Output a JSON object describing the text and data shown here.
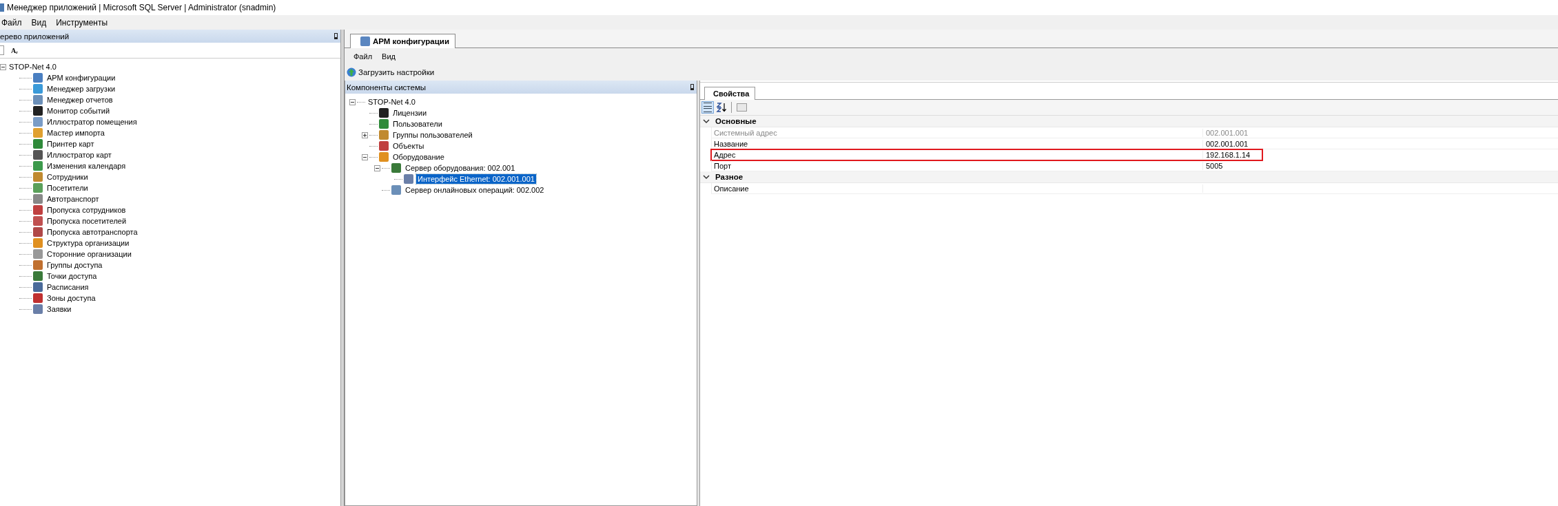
{
  "window": {
    "title": "Менеджер приложений | Microsoft SQL Server | Administrator  (snadmin)"
  },
  "menu": [
    "Файл",
    "Вид",
    "Инструменты"
  ],
  "app_tree": {
    "title": "ерево приложений",
    "toolbar": [
      "Aᵣ"
    ],
    "root": {
      "label": "STOP-Net 4.0",
      "expanded": true,
      "children": [
        {
          "label": "АРМ конфигурации"
        },
        {
          "label": "Менеджер загрузки"
        },
        {
          "label": "Менеджер отчетов"
        },
        {
          "label": "Монитор событий"
        },
        {
          "label": "Иллюстратор помещения"
        },
        {
          "label": "Мастер импорта"
        },
        {
          "label": "Принтер карт"
        },
        {
          "label": "Иллюстратор карт"
        },
        {
          "label": "Изменения календаря"
        },
        {
          "label": "Сотрудники"
        },
        {
          "label": "Посетители"
        },
        {
          "label": "Автотранспорт"
        },
        {
          "label": "Пропуска сотрудников"
        },
        {
          "label": "Пропуска посетителей"
        },
        {
          "label": "Пропуска автотранспорта"
        },
        {
          "label": "Структура организации"
        },
        {
          "label": "Сторонние организации"
        },
        {
          "label": "Группы доступа"
        },
        {
          "label": "Точки доступа"
        },
        {
          "label": "Расписания"
        },
        {
          "label": "Зоны доступа"
        },
        {
          "label": "Заявки"
        }
      ]
    }
  },
  "document_tabs": [
    {
      "label": "АРМ конфигурации",
      "selected": true
    }
  ],
  "doc_menu": [
    "Файл",
    "Вид"
  ],
  "doc_toolbar": {
    "load_button": "Загрузить настройки"
  },
  "components": {
    "title": "Компоненты системы",
    "root": {
      "label": "STOP-Net 4.0",
      "expanded": true,
      "selected": false,
      "children": [
        {
          "label": "Лицензии",
          "selected": false
        },
        {
          "label": "Пользователи",
          "selected": false
        },
        {
          "label": "Группы пользователей",
          "expanded": false,
          "selected": false
        },
        {
          "label": "Объекты",
          "selected": false
        },
        {
          "label": "Оборудование",
          "expanded": true,
          "selected": false,
          "children": [
            {
              "label": "Сервер оборудования: 002.001",
              "expanded": true,
              "selected": false,
              "children": [
                {
                  "label": "Интерфейс Ethernet: 002.001.001",
                  "selected": true
                }
              ]
            },
            {
              "label": "Сервер онлайновых операций: 002.002",
              "selected": false
            }
          ]
        }
      ]
    }
  },
  "properties": {
    "tabs": [
      {
        "label": "Свойства",
        "selected": true
      }
    ],
    "categories": [
      {
        "name": "Основные",
        "expanded": true,
        "rows": [
          {
            "name": "Системный адрес",
            "value": "002.001.001",
            "readonly": true,
            "highlighted": false
          },
          {
            "name": "Название",
            "value": "002.001.001",
            "readonly": false,
            "highlighted": false
          },
          {
            "name": "Адрес",
            "value": "192.168.1.14",
            "readonly": false,
            "highlighted": true
          },
          {
            "name": "Порт",
            "value": "5005",
            "readonly": false,
            "highlighted": false
          }
        ]
      },
      {
        "name": "Разное",
        "expanded": true,
        "rows": [
          {
            "name": "Описание",
            "value": "",
            "readonly": false,
            "highlighted": false
          }
        ]
      }
    ]
  }
}
